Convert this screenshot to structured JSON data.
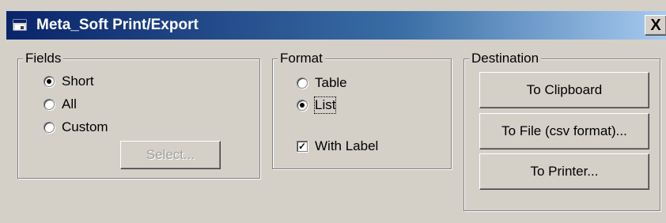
{
  "window": {
    "title": "Meta_Soft Print/Export",
    "close_glyph": "X",
    "title_icon": "app-window-icon"
  },
  "fields": {
    "legend": "Fields",
    "options": [
      {
        "label": "Short",
        "selected": true
      },
      {
        "label": "All",
        "selected": false
      },
      {
        "label": "Custom",
        "selected": false
      }
    ],
    "select_button": {
      "label": "Select...",
      "enabled": false
    }
  },
  "format": {
    "legend": "Format",
    "options": [
      {
        "label": "Table",
        "selected": false
      },
      {
        "label": "List",
        "selected": true
      }
    ],
    "with_label": {
      "label": "With Label",
      "checked": true
    }
  },
  "destination": {
    "legend": "Destination",
    "buttons": [
      {
        "label": "To Clipboard"
      },
      {
        "label": "To File (csv format)..."
      },
      {
        "label": "To Printer..."
      }
    ]
  },
  "colors": {
    "face": "#d4d0c8",
    "titlebar_start": "#0a246a",
    "titlebar_end": "#a6caf0"
  }
}
